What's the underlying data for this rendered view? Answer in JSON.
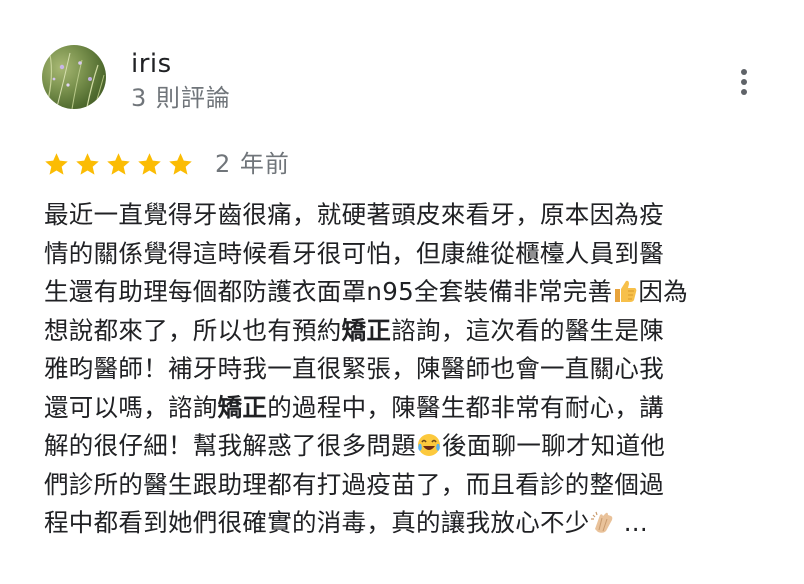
{
  "reviewer": {
    "name": "iris",
    "review_count": "3 則評論"
  },
  "rating": {
    "stars": 5,
    "max_stars": 5,
    "color": "#fbbc04",
    "time": "2 年前"
  },
  "review": {
    "lines": [
      [
        "最近一直覺得牙齒很痛，就硬著頭皮來看牙，原本因為疫"
      ],
      [
        "情的關係覺得這時候看牙很可怕，但康維從櫃檯人員到醫"
      ],
      [
        "生還有助理每個都防護衣面罩n95全套裝備非常完善",
        "因為"
      ],
      [
        "想說都來了，所以也有預約",
        "矯正",
        "諮詢，這次看的醫生是陳"
      ],
      [
        "雅昀醫師！補牙時我一直很緊張，陳醫師也會一直關心我"
      ],
      [
        "還可以嗎，諮詢",
        "矯正",
        "的過程中，陳醫生都非常有耐心，講"
      ],
      [
        "解的很仔細！幫我解惑了很多問題",
        "後面聊一聊才知道他"
      ],
      [
        "們診所的醫生跟助理都有打過疫苗了，而且看診的整個過"
      ],
      [
        "程中都看到她們很確實的消毒，真的讓我放心不少",
        " ..."
      ]
    ]
  },
  "icons": {
    "more": "more-vert-icon",
    "thumbs_up": "thumbs-up-emoji",
    "laughing": "tears-of-joy-emoji",
    "clapping": "clapping-hands-emoji"
  }
}
